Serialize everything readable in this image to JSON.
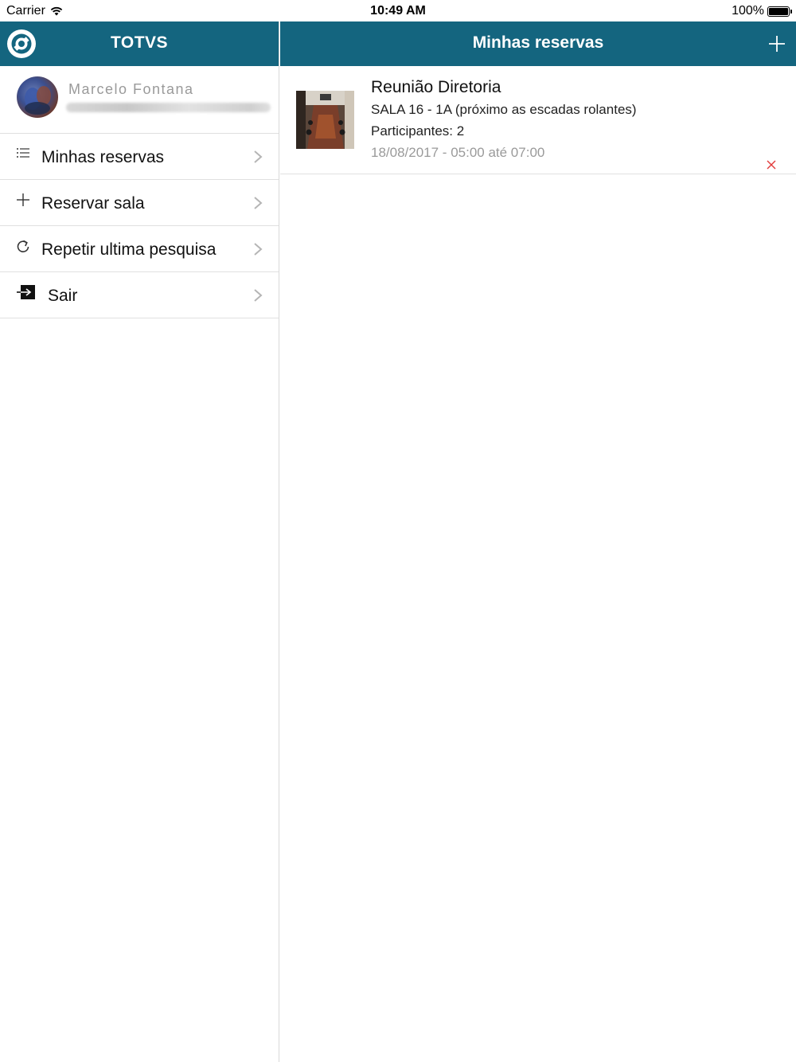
{
  "status_bar": {
    "carrier": "Carrier",
    "time": "10:49 AM",
    "battery": "100%"
  },
  "colors": {
    "header_bg": "#14657f",
    "header_text": "#ffffff",
    "delete_icon": "#e23b3b"
  },
  "master": {
    "title": "TOTVS",
    "profile": {
      "name": "Marcelo Fontana"
    },
    "menu": [
      {
        "label": "Minhas reservas",
        "icon": "list-icon"
      },
      {
        "label": "Reservar sala",
        "icon": "plus-icon"
      },
      {
        "label": "Repetir ultima pesquisa",
        "icon": "refresh-icon"
      },
      {
        "label": "Sair",
        "icon": "logout-icon"
      }
    ]
  },
  "detail": {
    "title": "Minhas reservas",
    "reservations": [
      {
        "title": "Reunião Diretoria",
        "room": "SALA 16 - 1A (próximo as escadas rolantes)",
        "participants": "Participantes: 2",
        "datetime": "18/08/2017 - 05:00 até 07:00"
      }
    ]
  }
}
